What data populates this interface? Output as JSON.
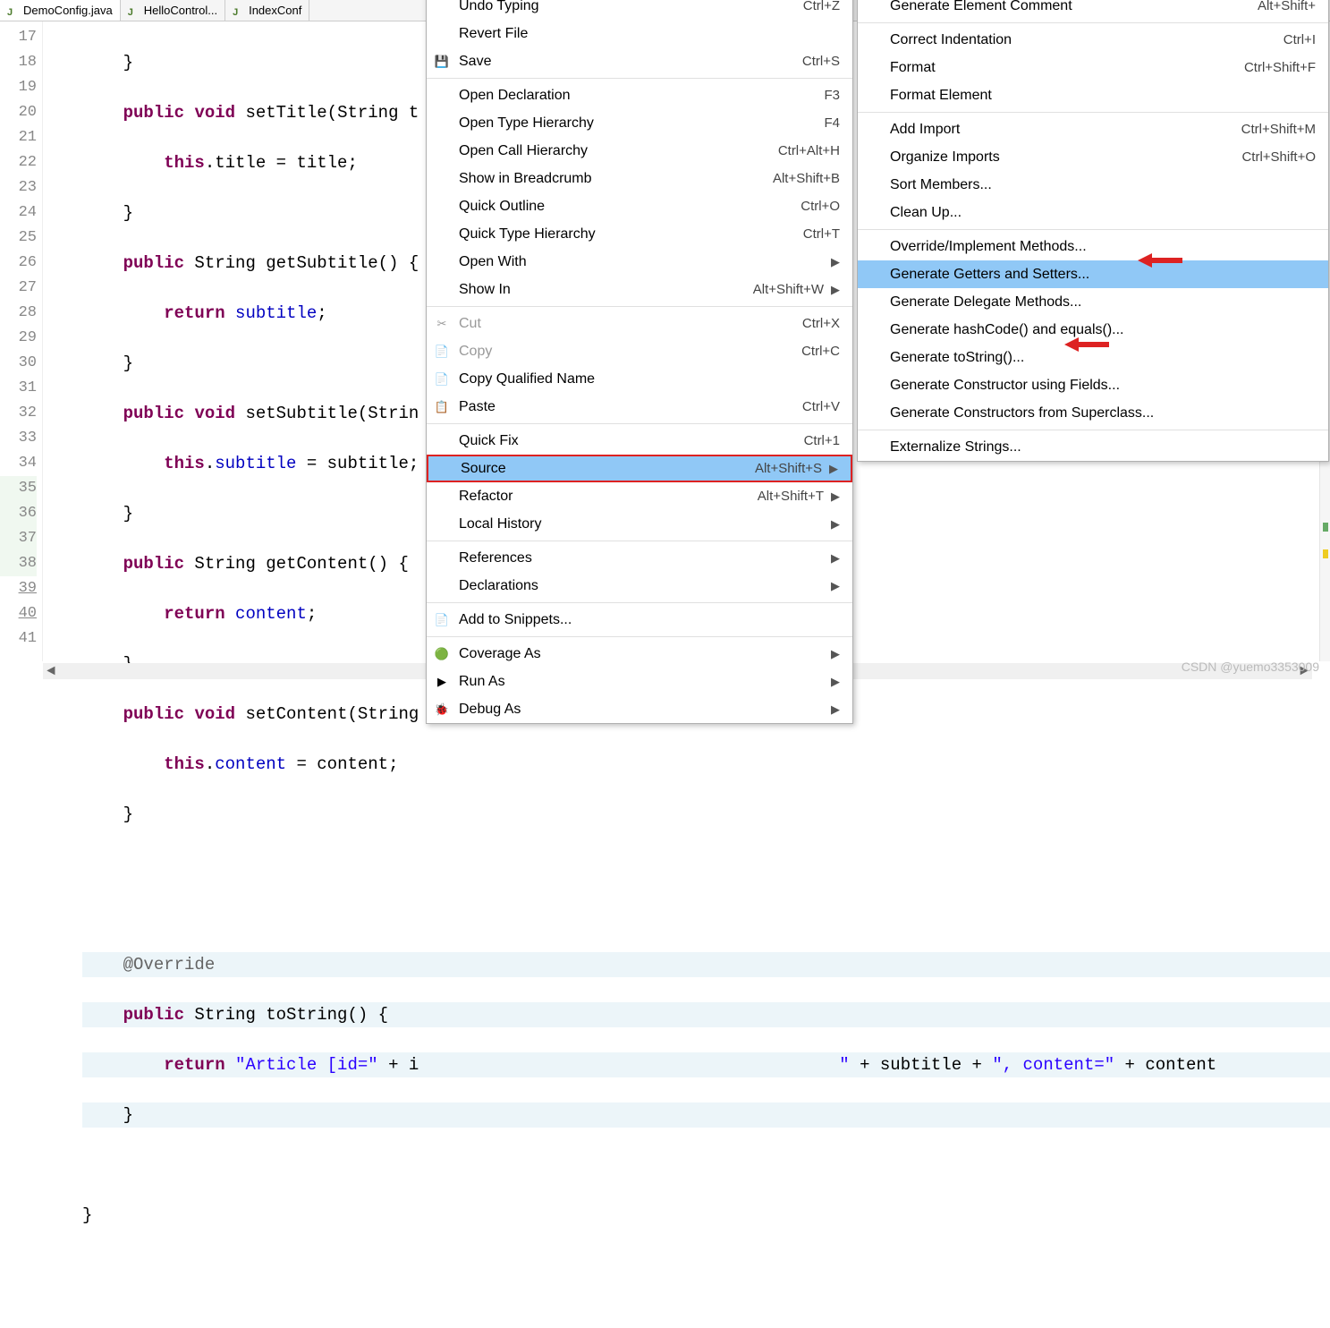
{
  "tabs": [
    {
      "label": "DemoConfig.java",
      "active": true
    },
    {
      "label": "HelloControl...",
      "active": false
    },
    {
      "label": "IndexConf",
      "active": false
    }
  ],
  "gutter": [
    "17",
    "18",
    "19",
    "20",
    "21",
    "22",
    "23",
    "24",
    "25",
    "26",
    "27",
    "28",
    "29",
    "30",
    "31",
    "32",
    "33",
    "34",
    "35",
    "36",
    "37",
    "38",
    "39",
    "40",
    "41"
  ],
  "code": {
    "l17": "    }",
    "l18_kw1": "public",
    "l18_kw2": "void",
    "l18_rest": " setTitle(String t",
    "l19_kw": "this",
    "l19_rest": ".title = title;",
    "l20": "    }",
    "l21_kw": "public",
    "l21_rest": " String getSubtitle() {",
    "l22_kw": "return",
    "l22_id": " subtitle",
    "l22_semi": ";",
    "l23": "    }",
    "l24_kw1": "public",
    "l24_kw2": "void",
    "l24_rest": " setSubtitle(Strin",
    "l25_kw": "this",
    "l25_dot": ".",
    "l25_fld": "subtitle",
    "l25_eq": " = subtitle;",
    "l26": "    }",
    "l27_kw": "public",
    "l27_rest": " String getContent() {",
    "l28_kw": "return",
    "l28_id": " content",
    "l28_semi": ";",
    "l29": "    }",
    "l30_kw1": "public",
    "l30_kw2": "void",
    "l30_rest": " setContent(String",
    "l31_kw": "this",
    "l31_dot": ".",
    "l31_fld": "content",
    "l31_eq": " = content;",
    "l32": "    }",
    "l33": "",
    "l34": "",
    "l35_anno": "@Override",
    "l36_kw": "public",
    "l36_rest": " String toString() {",
    "l37_kw": "return",
    "l37_s1": " \"Article [id=\"",
    "l37_p1": " + i",
    "l37_s2_right": "\"",
    "l37_p2": " + subtitle + ",
    "l37_s3": "\", content=\"",
    "l37_p3": " + content",
    "l38": "    }",
    "l39": "",
    "l40": "}",
    "l41": ""
  },
  "menu1_top": [
    {
      "label": "Undo Typing",
      "shortcut": "Ctrl+Z",
      "cut": true
    },
    {
      "label": "Revert File",
      "shortcut": ""
    },
    {
      "label": "Save",
      "shortcut": "Ctrl+S",
      "icon": "💾"
    }
  ],
  "menu1_nav": [
    {
      "label": "Open Declaration",
      "shortcut": "F3"
    },
    {
      "label": "Open Type Hierarchy",
      "shortcut": "F4"
    },
    {
      "label": "Open Call Hierarchy",
      "shortcut": "Ctrl+Alt+H"
    },
    {
      "label": "Show in Breadcrumb",
      "shortcut": "Alt+Shift+B"
    },
    {
      "label": "Quick Outline",
      "shortcut": "Ctrl+O"
    },
    {
      "label": "Quick Type Hierarchy",
      "shortcut": "Ctrl+T"
    },
    {
      "label": "Open With",
      "shortcut": "",
      "arrow": true
    },
    {
      "label": "Show In",
      "shortcut": "Alt+Shift+W",
      "arrow": true
    }
  ],
  "menu1_edit": [
    {
      "label": "Cut",
      "shortcut": "Ctrl+X",
      "disabled": true,
      "icon": "✂"
    },
    {
      "label": "Copy",
      "shortcut": "Ctrl+C",
      "disabled": true,
      "icon": "📄"
    },
    {
      "label": "Copy Qualified Name",
      "shortcut": "",
      "icon": "📄"
    },
    {
      "label": "Paste",
      "shortcut": "Ctrl+V",
      "icon": "📋"
    }
  ],
  "menu1_src": [
    {
      "label": "Quick Fix",
      "shortcut": "Ctrl+1"
    },
    {
      "label": "Source",
      "shortcut": "Alt+Shift+S",
      "arrow": true,
      "selected": true,
      "boxed": true
    },
    {
      "label": "Refactor",
      "shortcut": "Alt+Shift+T",
      "arrow": true
    },
    {
      "label": "Local History",
      "shortcut": "",
      "arrow": true
    }
  ],
  "menu1_ref": [
    {
      "label": "References",
      "shortcut": "",
      "arrow": true
    },
    {
      "label": "Declarations",
      "shortcut": "",
      "arrow": true
    }
  ],
  "menu1_snip": [
    {
      "label": "Add to Snippets...",
      "shortcut": "",
      "icon": "📄"
    }
  ],
  "menu1_run": [
    {
      "label": "Coverage As",
      "shortcut": "",
      "arrow": true,
      "icon": "🟢"
    },
    {
      "label": "Run As",
      "shortcut": "",
      "arrow": true,
      "icon": "▶"
    },
    {
      "label": "Debug As",
      "shortcut": "",
      "arrow": true,
      "icon": "🐞"
    }
  ],
  "menu2_top": [
    {
      "label": "Generate Element Comment",
      "shortcut": "Alt+Shift+",
      "cut": true
    }
  ],
  "menu2_fmt": [
    {
      "label": "Correct Indentation",
      "shortcut": "Ctrl+I"
    },
    {
      "label": "Format",
      "shortcut": "Ctrl+Shift+F"
    },
    {
      "label": "Format Element",
      "shortcut": ""
    }
  ],
  "menu2_imp": [
    {
      "label": "Add Import",
      "shortcut": "Ctrl+Shift+M"
    },
    {
      "label": "Organize Imports",
      "shortcut": "Ctrl+Shift+O"
    },
    {
      "label": "Sort Members...",
      "shortcut": ""
    },
    {
      "label": "Clean Up...",
      "shortcut": ""
    }
  ],
  "menu2_gen": [
    {
      "label": "Override/Implement Methods...",
      "shortcut": ""
    },
    {
      "label": "Generate Getters and Setters...",
      "shortcut": "",
      "selected": true
    },
    {
      "label": "Generate Delegate Methods...",
      "shortcut": ""
    },
    {
      "label": "Generate hashCode() and equals()...",
      "shortcut": ""
    },
    {
      "label": "Generate toString()...",
      "shortcut": ""
    },
    {
      "label": "Generate Constructor using Fields...",
      "shortcut": ""
    },
    {
      "label": "Generate Constructors from Superclass...",
      "shortcut": ""
    }
  ],
  "menu2_ext": [
    {
      "label": "Externalize Strings...",
      "shortcut": ""
    }
  ],
  "watermark": "CSDN @yuemo3353009"
}
